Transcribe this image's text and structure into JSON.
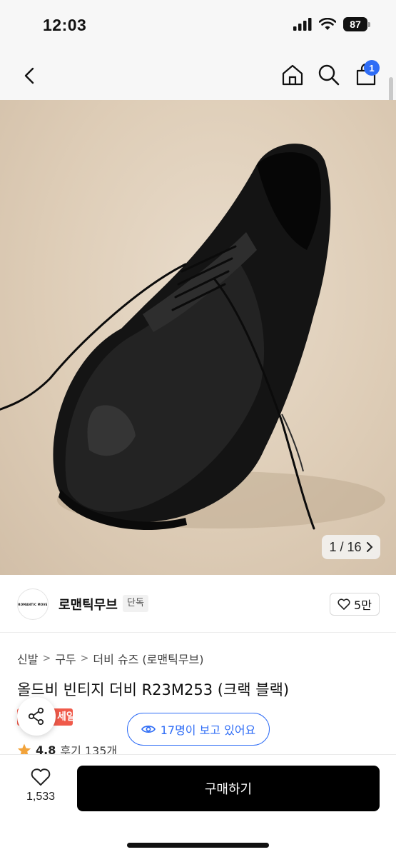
{
  "status_bar": {
    "time": "12:03",
    "battery": "87"
  },
  "header": {
    "cart_count": "1"
  },
  "gallery": {
    "counter": "1 / 16"
  },
  "brand": {
    "logo_text": "ROMANTIC MOVE",
    "name": "로맨틱무브",
    "tag": "단독",
    "likes": "5만"
  },
  "breadcrumb": [
    "신발",
    "구두",
    "더비 슈즈 (로맨틱무브)"
  ],
  "product": {
    "title": "올드비 빈티지 더비 R23M253 (크랙 블랙)",
    "sale_badge": "세일",
    "viewers": "17명이 보고 있어요",
    "rating": "4.8",
    "reviews": "후기 135개"
  },
  "bottom_bar": {
    "wish_count": "1,533",
    "buy_label": "구매하기"
  },
  "colors": {
    "accent": "#2f6df6",
    "sale": "#f05a4a",
    "star": "#f2a33a",
    "buy_button": "#000000"
  }
}
